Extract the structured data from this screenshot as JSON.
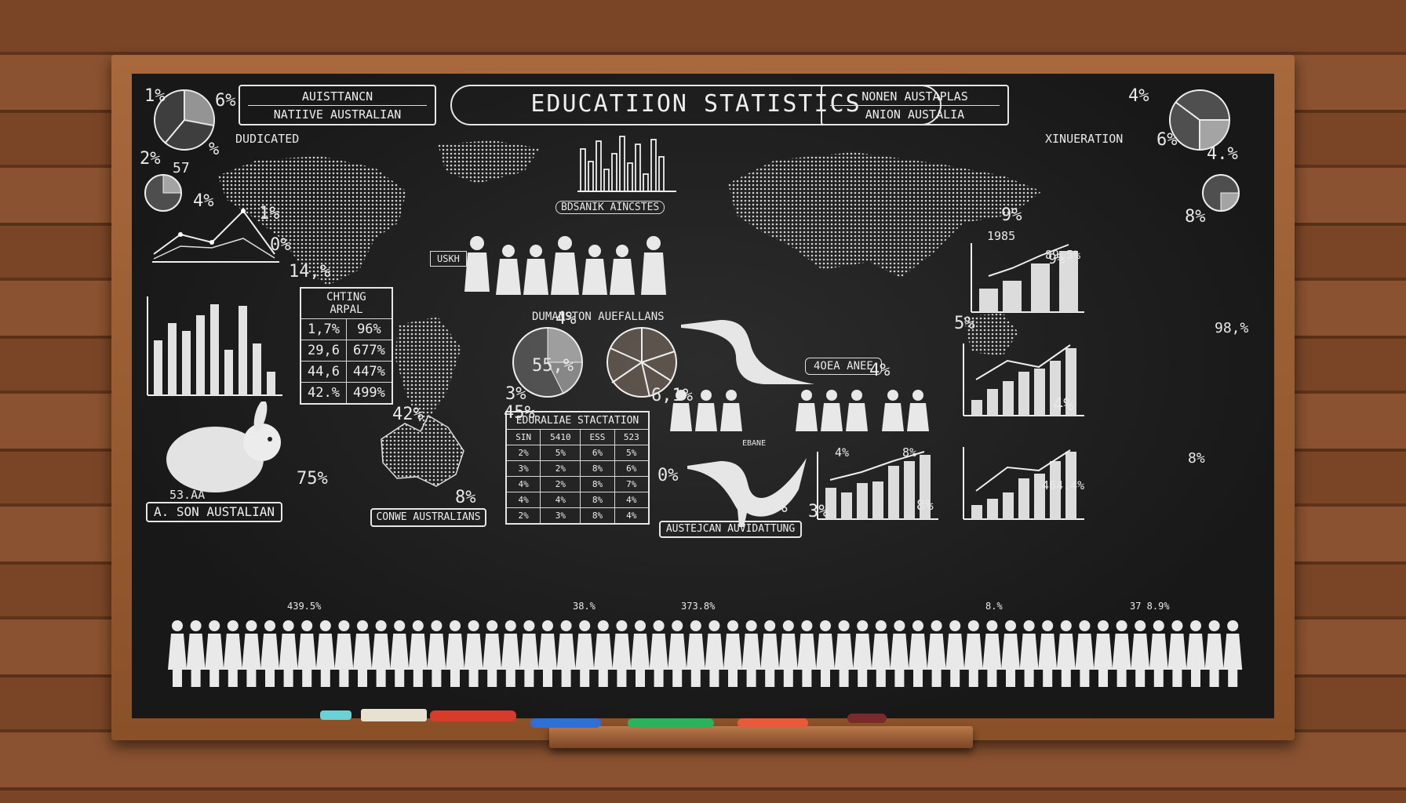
{
  "title": "EDUCATIION STATISTICS",
  "top_left_box": {
    "line1": "AUISTTANCN",
    "line2": "NATIIVE AUSTRALIAN",
    "mark": "%"
  },
  "top_right_box": {
    "line1": "NONEN AUSTAPLAS",
    "line2": "ANION AUSTALIA"
  },
  "labels": {
    "dudicated": "DUDICATED",
    "xinueration": "XINUERATION",
    "bdsanik": "BDSANIK AINCSTES",
    "dumanston": "DUMANSTON AUEFALLANS",
    "ojea": "4OEA ANEE",
    "ason": "A. SON AUSTALIAN",
    "conwe": "CONWE AUSTRALIANS",
    "austejcan": "AUSTEJCAN AUVIDATTUNG",
    "uskh": "USKH",
    "ebane": "EBANE"
  },
  "numbers": [
    "1%",
    "6%",
    "2%",
    "%",
    "57",
    "4%",
    "1%",
    "0%",
    "14,%",
    "4%",
    "55,%",
    "3%",
    "42%",
    "45%",
    "75%",
    "8%",
    "6,1%",
    "0%",
    "38%",
    "3%",
    "4%",
    "5%",
    "4%",
    "6%",
    "4.%",
    "9%",
    "8%",
    "9%",
    "98,%",
    "8%",
    "8%",
    "53.AA",
    "1985",
    "89.5%",
    "464.4%",
    "4%",
    "8%",
    "4%"
  ],
  "chting_table": {
    "title": "CHTING ARPAL",
    "rows": [
      [
        "1,7%",
        "96%"
      ],
      [
        "29,6",
        "677%"
      ],
      [
        "44,6",
        "447%"
      ],
      [
        "42.%",
        "499%"
      ]
    ]
  },
  "edu_table": {
    "title": "EDURALIAE STACTATION",
    "rows": [
      [
        "SIN",
        "5410",
        "ESS",
        "523"
      ],
      [
        "2%",
        "5%",
        "6%",
        "5%"
      ],
      [
        "3%",
        "2%",
        "8%",
        "6%"
      ],
      [
        "4%",
        "2%",
        "8%",
        "7%"
      ],
      [
        "4%",
        "4%",
        "8%",
        "4%"
      ],
      [
        "2%",
        "3%",
        "8%",
        "4%"
      ]
    ]
  },
  "crowd_numbers": [
    "439.5%",
    "38.%",
    "373.8%",
    "8.%",
    "37 8.9%"
  ],
  "colors": {
    "board": "#1e1e1e",
    "chalk": "#eeeeee",
    "wood": "#7a4527"
  }
}
